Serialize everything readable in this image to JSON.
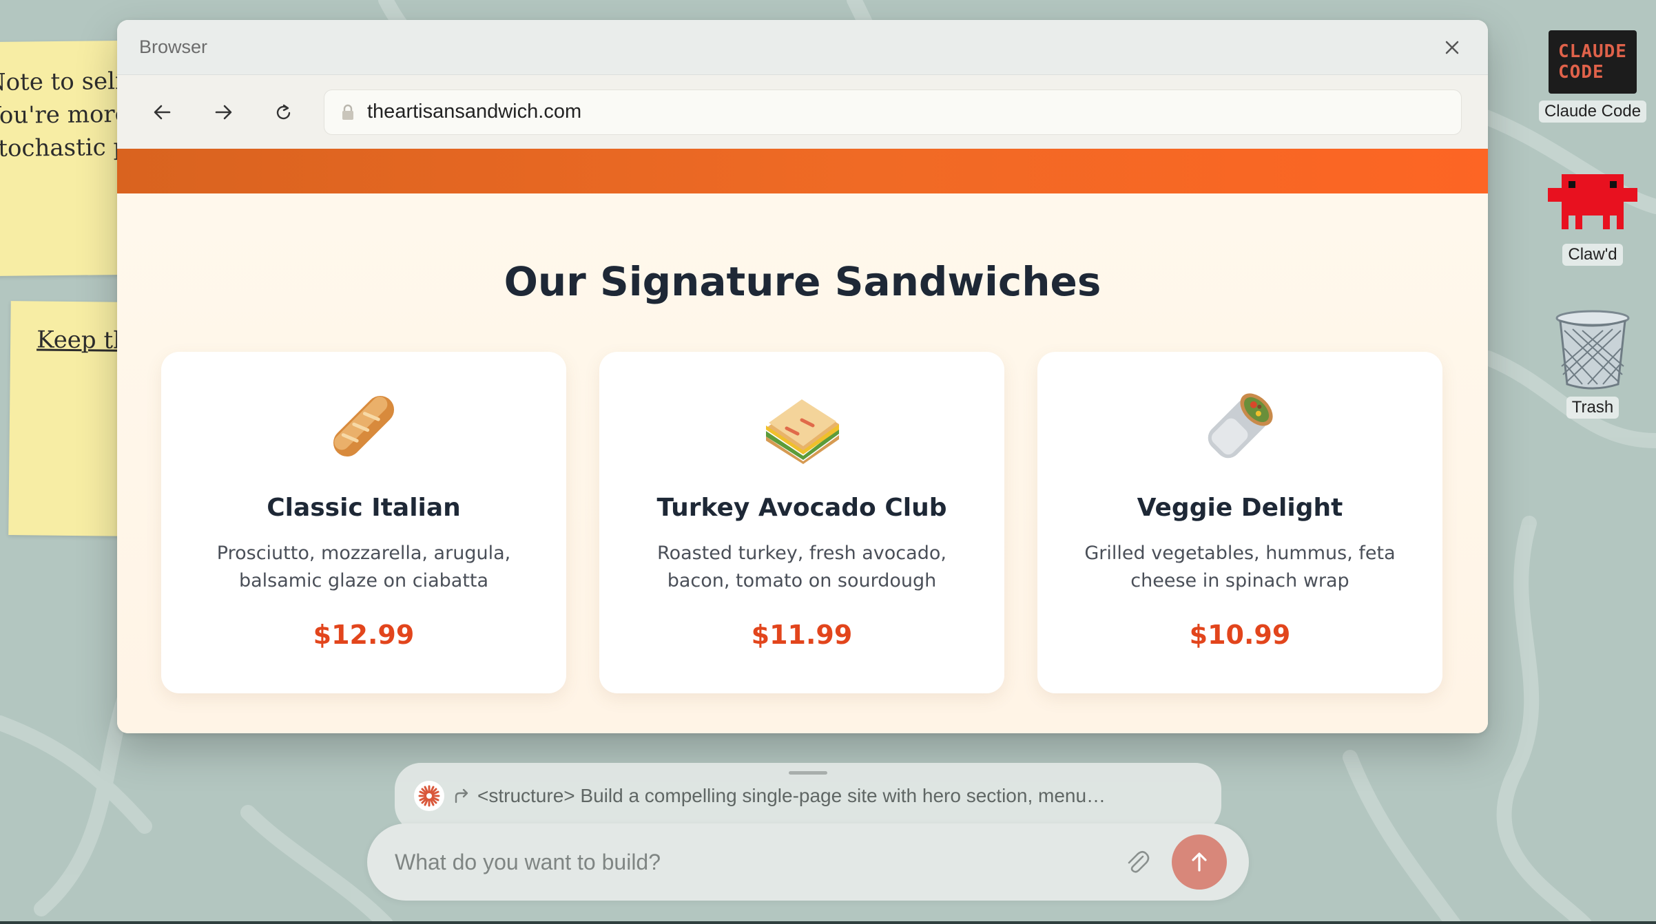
{
  "desktop": {
    "colors": {
      "background": "#b3c6c0",
      "sticky": "#f7eda4"
    },
    "sticky_notes": [
      {
        "text": "Note to self:\nYou're more\nstochastic p"
      },
      {
        "text": "Keep th"
      }
    ],
    "icons": [
      {
        "label": "Claude Code",
        "art_text": "CLAUDE\nCODE",
        "icon": "claude-code-terminal-icon"
      },
      {
        "label": "Claw'd",
        "icon": "clawd-pixel-icon"
      },
      {
        "label": "Trash",
        "icon": "trash-icon"
      }
    ]
  },
  "browser": {
    "title": "Browser",
    "url": "theartisansandwich.com",
    "page": {
      "section_title": "Our Signature Sandwiches",
      "accent_color": "#f06a25",
      "price_color": "#e2451c",
      "cards": [
        {
          "icon": "baguette-icon",
          "name": "Classic Italian",
          "description": "Prosciutto, mozzarella, arugula, balsamic glaze on ciabatta",
          "price": "$12.99"
        },
        {
          "icon": "sandwich-icon",
          "name": "Turkey Avocado Club",
          "description": "Roasted turkey, fresh avocado, bacon, tomato on sourdough",
          "price": "$11.99"
        },
        {
          "icon": "burrito-wrap-icon",
          "name": "Veggie Delight",
          "description": "Grilled vegetables, hummus, feta cheese in spinach wrap",
          "price": "$10.99"
        }
      ]
    }
  },
  "prompt": {
    "task_text": "<structure> Build a compelling single-page site with hero section, menu…",
    "placeholder": "What do you want to build?",
    "send_color": "#d8877a"
  }
}
